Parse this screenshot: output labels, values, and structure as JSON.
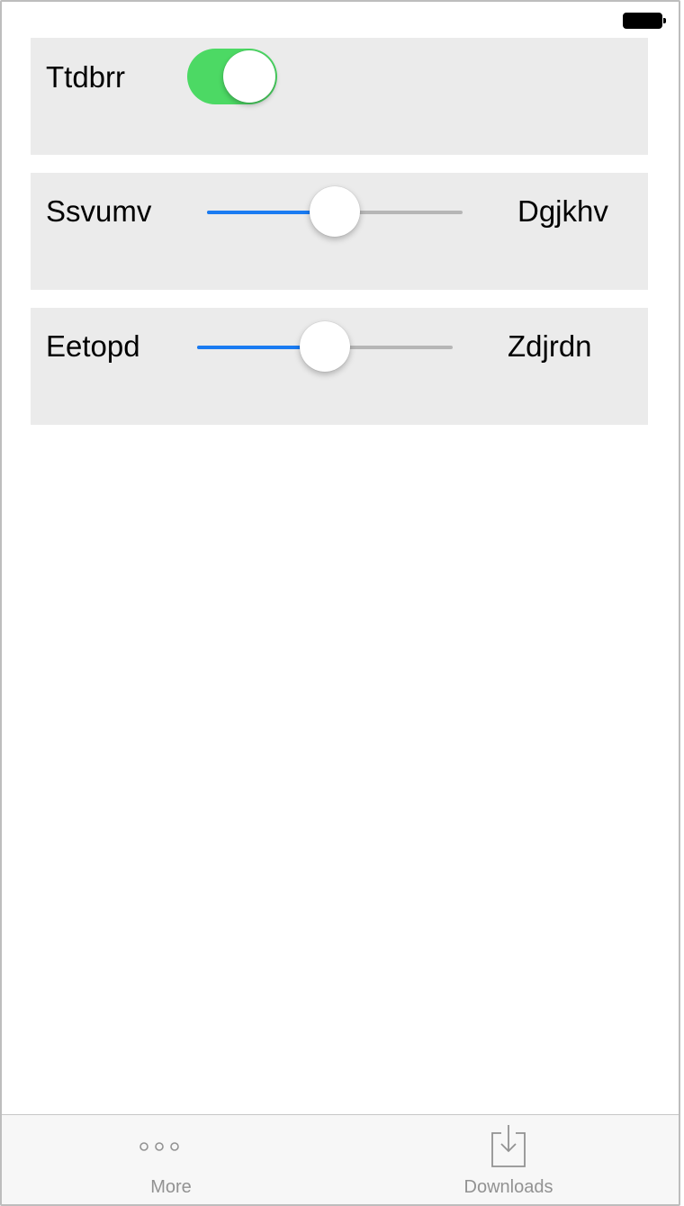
{
  "status_bar": {
    "battery_icon": "battery-full-icon"
  },
  "settings": {
    "toggle_row": {
      "label": "Ttdbrr",
      "on": true,
      "on_color": "#4cd964"
    },
    "slider_rows": [
      {
        "min_label": "Ssvumv",
        "max_label": "Dgjkhv",
        "value": 0.5
      },
      {
        "min_label": "Eetopd",
        "max_label": "Zdjrdn",
        "value": 0.5
      }
    ],
    "slider_fill_color": "#1a7bf2"
  },
  "tabbar": {
    "tabs": [
      {
        "label": "More",
        "icon": "more-dots-icon"
      },
      {
        "label": "Downloads",
        "icon": "download-tray-icon"
      }
    ]
  }
}
